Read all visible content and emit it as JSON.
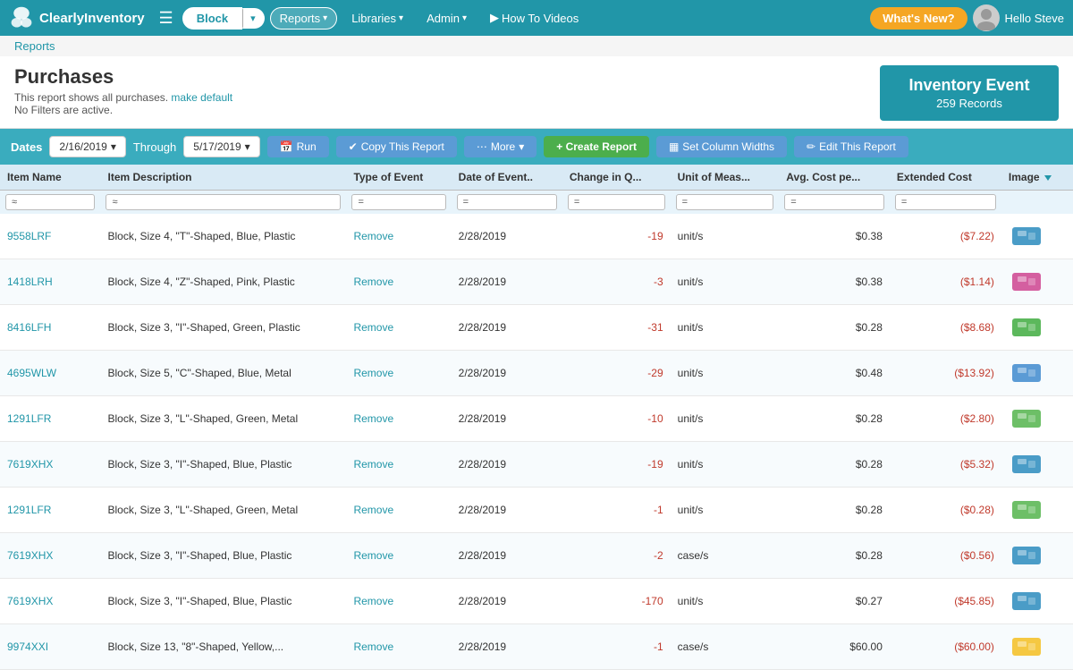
{
  "app": {
    "brand": "ClearlyInventory",
    "nav_items": [
      {
        "label": "Block",
        "active": true
      },
      {
        "label": "Reports",
        "active": true
      },
      {
        "label": "Libraries"
      },
      {
        "label": "Admin"
      },
      {
        "label": "How To Videos"
      }
    ],
    "whats_new": "What's New?",
    "user_greeting": "Hello Steve"
  },
  "breadcrumb": {
    "items": [
      "Reports"
    ]
  },
  "page": {
    "title": "Purchases",
    "subtitle": "This report shows all purchases.",
    "make_default_link": "make default",
    "no_filters": "No Filters are active."
  },
  "inventory_event": {
    "title": "Inventory Event",
    "records": "259 Records"
  },
  "toolbar": {
    "dates_label": "Dates",
    "date_from": "2/16/2019",
    "through_label": "Through",
    "date_to": "5/17/2019",
    "run_btn": "Run",
    "copy_btn": "Copy This Report",
    "more_btn": "More",
    "create_btn": "+ Create Report",
    "set_col_btn": "Set Column Widths",
    "edit_btn": "Edit This Report"
  },
  "table": {
    "columns": [
      {
        "key": "item_name",
        "label": "Item Name"
      },
      {
        "key": "item_desc",
        "label": "Item Description"
      },
      {
        "key": "type",
        "label": "Type of Event"
      },
      {
        "key": "date",
        "label": "Date of Event.."
      },
      {
        "key": "change",
        "label": "Change in Q..."
      },
      {
        "key": "unit",
        "label": "Unit of Meas..."
      },
      {
        "key": "avg_cost",
        "label": "Avg. Cost pe..."
      },
      {
        "key": "ext_cost",
        "label": "Extended Cost"
      },
      {
        "key": "image",
        "label": "Image"
      }
    ],
    "rows": [
      {
        "item_name": "9558LRF",
        "item_desc": "Block, Size 4, \"T\"-Shaped, Blue, Plastic",
        "type": "Remove",
        "date": "2/28/2019",
        "change": "-19",
        "unit": "unit/s",
        "avg_cost": "$0.38",
        "ext_cost": "($7.22)",
        "img_color": "blue"
      },
      {
        "item_name": "1418LRH",
        "item_desc": "Block, Size 4, \"Z\"-Shaped, Pink, Plastic",
        "type": "Remove",
        "date": "2/28/2019",
        "change": "-3",
        "unit": "unit/s",
        "avg_cost": "$0.38",
        "ext_cost": "($1.14)",
        "img_color": "pink"
      },
      {
        "item_name": "8416LFH",
        "item_desc": "Block, Size 3, \"I\"-Shaped, Green, Plastic",
        "type": "Remove",
        "date": "2/28/2019",
        "change": "-31",
        "unit": "unit/s",
        "avg_cost": "$0.28",
        "ext_cost": "($8.68)",
        "img_color": "green"
      },
      {
        "item_name": "4695WLW",
        "item_desc": "Block, Size 5, \"C\"-Shaped, Blue, Metal",
        "type": "Remove",
        "date": "2/28/2019",
        "change": "-29",
        "unit": "unit/s",
        "avg_cost": "$0.48",
        "ext_cost": "($13.92)",
        "img_color": "blueC"
      },
      {
        "item_name": "1291LFR",
        "item_desc": "Block, Size 3, \"L\"-Shaped, Green, Metal",
        "type": "Remove",
        "date": "2/28/2019",
        "change": "-10",
        "unit": "unit/s",
        "avg_cost": "$0.28",
        "ext_cost": "($2.80)",
        "img_color": "greenL"
      },
      {
        "item_name": "7619XHX",
        "item_desc": "Block, Size 3, \"I\"-Shaped, Blue, Plastic",
        "type": "Remove",
        "date": "2/28/2019",
        "change": "-19",
        "unit": "unit/s",
        "avg_cost": "$0.28",
        "ext_cost": "($5.32)",
        "img_color": "blue"
      },
      {
        "item_name": "1291LFR",
        "item_desc": "Block, Size 3, \"L\"-Shaped, Green, Metal",
        "type": "Remove",
        "date": "2/28/2019",
        "change": "-1",
        "unit": "unit/s",
        "avg_cost": "$0.28",
        "ext_cost": "($0.28)",
        "img_color": "greenL"
      },
      {
        "item_name": "7619XHX",
        "item_desc": "Block, Size 3, \"I\"-Shaped, Blue, Plastic",
        "type": "Remove",
        "date": "2/28/2019",
        "change": "-2",
        "unit": "case/s",
        "avg_cost": "$0.28",
        "ext_cost": "($0.56)",
        "img_color": "blue"
      },
      {
        "item_name": "7619XHX",
        "item_desc": "Block, Size 3, \"I\"-Shaped, Blue, Plastic",
        "type": "Remove",
        "date": "2/28/2019",
        "change": "-170",
        "unit": "unit/s",
        "avg_cost": "$0.27",
        "ext_cost": "($45.85)",
        "img_color": "blue"
      },
      {
        "item_name": "9974XXI",
        "item_desc": "Block, Size 13, \"8\"-Shaped, Yellow,...",
        "type": "Remove",
        "date": "2/28/2019",
        "change": "-1",
        "unit": "case/s",
        "avg_cost": "$60.00",
        "ext_cost": "($60.00)",
        "img_color": "yellow"
      }
    ]
  }
}
